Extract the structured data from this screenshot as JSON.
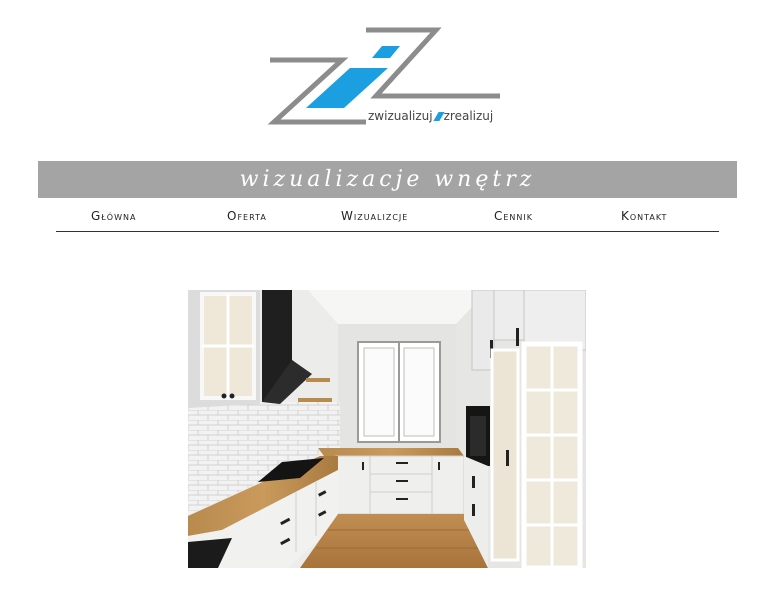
{
  "brand": {
    "logo_icon": "zz-logo-icon",
    "tagline_left": "zwizualizuj",
    "tagline_right": "zrealizuj",
    "colors": {
      "gray": "#8c8c8c",
      "accent": "#1b9fe0"
    }
  },
  "banner": {
    "title": "wizualizacje wnętrz",
    "background": "#a4a4a4"
  },
  "nav": {
    "items": [
      {
        "label": "Główna"
      },
      {
        "label": "Oferta"
      },
      {
        "label": "Wizualizcje"
      },
      {
        "label": "Cennik"
      },
      {
        "label": "Kontakt"
      }
    ]
  },
  "main": {
    "image_icon": "kitchen-visualization-image"
  }
}
